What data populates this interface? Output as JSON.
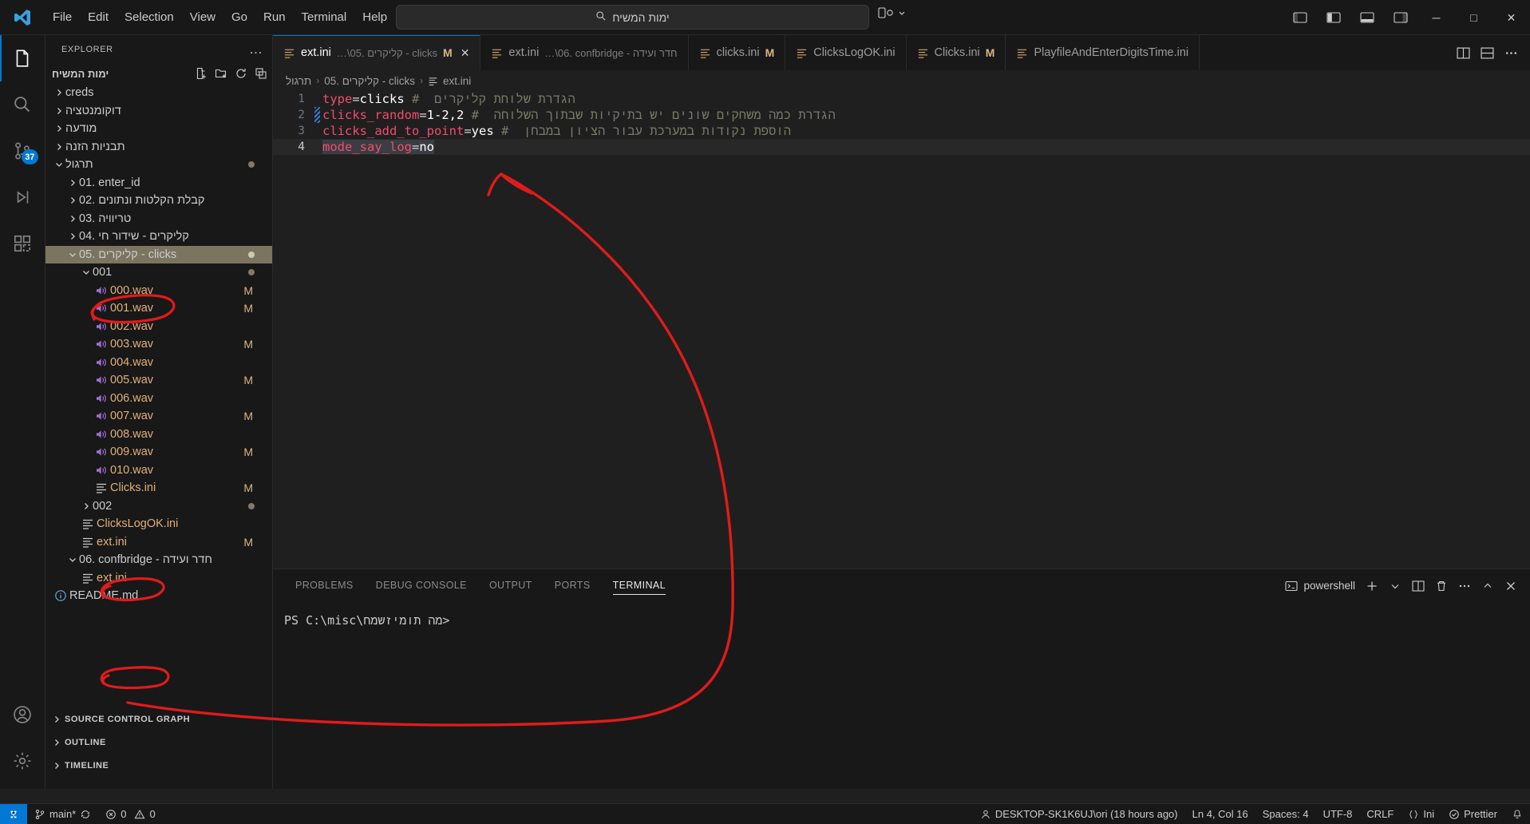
{
  "window": {
    "menu": [
      "File",
      "Edit",
      "Selection",
      "View",
      "Go",
      "Run",
      "Terminal",
      "Help"
    ],
    "search_placeholder": "ימות המשיח",
    "search_icon": "search-icon",
    "nav_back": "‹",
    "nav_forward": "›",
    "minimize": "─",
    "maximize": "□",
    "close": "✕"
  },
  "activitybar": {
    "items": [
      {
        "name": "explorer",
        "icon": "files-icon",
        "badge": ""
      },
      {
        "name": "search",
        "icon": "search-icon",
        "badge": ""
      },
      {
        "name": "source-control",
        "icon": "source-control-icon",
        "badge": "37"
      },
      {
        "name": "run-and-debug",
        "icon": "run-debug-icon",
        "badge": ""
      },
      {
        "name": "extensions",
        "icon": "extensions-icon",
        "badge": ""
      }
    ],
    "bottom": [
      {
        "name": "accounts",
        "icon": "account-icon"
      },
      {
        "name": "manage",
        "icon": "gear-icon"
      }
    ]
  },
  "sidebar": {
    "title": "EXPLORER",
    "more_label": "…",
    "root": "ימות המשיח",
    "root_actions": [
      "new-file-icon",
      "new-folder-icon",
      "refresh-icon",
      "collapse-all-icon"
    ],
    "tree": [
      {
        "label": "creds",
        "depth": 1,
        "type": "folder",
        "state": "collapsed",
        "badge": ""
      },
      {
        "label": "דוקומנטציה",
        "depth": 1,
        "type": "folder",
        "state": "collapsed",
        "badge": ""
      },
      {
        "label": "מודעה",
        "depth": 1,
        "type": "folder",
        "state": "collapsed",
        "badge": ""
      },
      {
        "label": "תבניות הזנה",
        "depth": 1,
        "type": "folder",
        "state": "collapsed",
        "badge": ""
      },
      {
        "label": "תרגול",
        "depth": 1,
        "type": "folder",
        "state": "expanded",
        "badge": "dot"
      },
      {
        "label": "01. enter_id",
        "depth": 2,
        "type": "folder",
        "state": "collapsed",
        "badge": ""
      },
      {
        "label": "02. קבלת הקלטות ונתונים",
        "depth": 2,
        "type": "folder",
        "state": "collapsed",
        "badge": ""
      },
      {
        "label": "03. טריוויה",
        "depth": 2,
        "type": "folder",
        "state": "collapsed",
        "badge": ""
      },
      {
        "label": "04. קליקרים - שידור חי",
        "depth": 2,
        "type": "folder",
        "state": "collapsed",
        "badge": ""
      },
      {
        "label": "05. קליקרים - clicks",
        "depth": 2,
        "type": "folder",
        "state": "expanded",
        "badge": "dot",
        "selected": true
      },
      {
        "label": "001",
        "depth": 3,
        "type": "folder",
        "state": "expanded",
        "badge": "dot",
        "circled": true
      },
      {
        "label": "000.wav",
        "depth": 4,
        "type": "wav",
        "badge": "M"
      },
      {
        "label": "001.wav",
        "depth": 4,
        "type": "wav",
        "badge": "M"
      },
      {
        "label": "002.wav",
        "depth": 4,
        "type": "wav",
        "badge": ""
      },
      {
        "label": "003.wav",
        "depth": 4,
        "type": "wav",
        "badge": "M"
      },
      {
        "label": "004.wav",
        "depth": 4,
        "type": "wav",
        "badge": ""
      },
      {
        "label": "005.wav",
        "depth": 4,
        "type": "wav",
        "badge": "M"
      },
      {
        "label": "006.wav",
        "depth": 4,
        "type": "wav",
        "badge": ""
      },
      {
        "label": "007.wav",
        "depth": 4,
        "type": "wav",
        "badge": "M"
      },
      {
        "label": "008.wav",
        "depth": 4,
        "type": "wav",
        "badge": ""
      },
      {
        "label": "009.wav",
        "depth": 4,
        "type": "wav",
        "badge": "M"
      },
      {
        "label": "010.wav",
        "depth": 4,
        "type": "wav",
        "badge": ""
      },
      {
        "label": "Clicks.ini",
        "depth": 4,
        "type": "ini",
        "badge": "M"
      },
      {
        "label": "002",
        "depth": 3,
        "type": "folder",
        "state": "collapsed",
        "badge": "dot",
        "circled": true
      },
      {
        "label": "ClicksLogOK.ini",
        "depth": 3,
        "type": "ini",
        "badge": ""
      },
      {
        "label": "ext.ini",
        "depth": 3,
        "type": "ini",
        "badge": "M"
      },
      {
        "label": "06. confbridge - חדר ועידה",
        "depth": 2,
        "type": "folder",
        "state": "expanded",
        "badge": ""
      },
      {
        "label": "ext.ini",
        "depth": 3,
        "type": "ini",
        "badge": "",
        "circled": true
      },
      {
        "label": "README.md",
        "depth": 1,
        "type": "md",
        "badge": ""
      }
    ],
    "sections": [
      "SOURCE CONTROL GRAPH",
      "OUTLINE",
      "TIMELINE"
    ]
  },
  "editor": {
    "tabs": [
      {
        "name": "ext.ini",
        "path": "…\\05. קליקרים - clicks",
        "modified": "M",
        "active": true,
        "closable": true
      },
      {
        "name": "ext.ini",
        "path": "…\\06. confbridge - חדר ועידה",
        "modified": "",
        "active": false,
        "closable": false
      },
      {
        "name": "clicks.ini",
        "path": "",
        "modified": "M",
        "active": false,
        "closable": false
      },
      {
        "name": "ClicksLogOK.ini",
        "path": "",
        "modified": "",
        "active": false,
        "closable": false
      },
      {
        "name": "Clicks.ini",
        "path": "",
        "modified": "M",
        "active": false,
        "closable": false
      },
      {
        "name": "PlayfileAndEnterDigitsTime.ini",
        "path": "",
        "modified": "",
        "active": false,
        "closable": false
      }
    ],
    "tab_actions": [
      "split-editor-icon",
      "layout-icon",
      "more-actions-icon"
    ],
    "breadcrumb": [
      "תרגול",
      "05. קליקרים - clicks",
      "ext.ini"
    ],
    "lines": [
      {
        "num": "1",
        "key": "type",
        "eq": "=",
        "val": "clicks",
        "comment": "#  הגדרת שלוחת קליקרים"
      },
      {
        "num": "2",
        "key": "clicks_random",
        "eq": "=",
        "val": "1-2,2",
        "comment": "#  הגדרת כמה משחקים שונים יש בתיקיות שבתוך השלוחה",
        "squiggle": true
      },
      {
        "num": "3",
        "key": "clicks_add_to_point",
        "eq": "=",
        "val": "yes",
        "comment": "#  הוספת נקודות במערכת עבור הציון במבחן"
      },
      {
        "num": "4",
        "key": "mode_say_log",
        "eq": "=",
        "val": "no",
        "comment": "",
        "current": true,
        "selected": true
      }
    ]
  },
  "panel": {
    "tabs": [
      "PROBLEMS",
      "DEBUG CONSOLE",
      "OUTPUT",
      "PORTS",
      "TERMINAL"
    ],
    "active_tab": "TERMINAL",
    "shell_label": "powershell",
    "actions": [
      "new-terminal-icon",
      "chevron-down-icon",
      "split-terminal-icon",
      "trash-icon",
      "more-actions-icon",
      "chevron-up-icon",
      "close-icon"
    ],
    "prompt": "PS C:\\misc\\מה תומיזשמח>"
  },
  "statusbar": {
    "remote_icon": "remote-icon",
    "branch": "main*",
    "sync_icon": "sync-icon",
    "errors": "0",
    "warnings": "0",
    "error_icon": "error-icon",
    "warning_icon": "warning-icon",
    "right": [
      {
        "name": "live-share",
        "label": "DESKTOP-SK1K6UJ\\ori (18 hours ago)",
        "icon": "account-icon"
      },
      {
        "name": "cursor-position",
        "label": "Ln 4, Col 16",
        "icon": ""
      },
      {
        "name": "indentation",
        "label": "Spaces: 4",
        "icon": ""
      },
      {
        "name": "encoding",
        "label": "UTF-8",
        "icon": ""
      },
      {
        "name": "eol",
        "label": "CRLF",
        "icon": ""
      },
      {
        "name": "language-mode",
        "label": "Ini",
        "icon": "braces-icon"
      },
      {
        "name": "prettier",
        "label": "Prettier",
        "icon": "check-circle-icon"
      },
      {
        "name": "notifications",
        "label": "",
        "icon": "bell-icon"
      }
    ]
  },
  "colors": {
    "accent": "#0078d4",
    "annotation": "#e01b1b",
    "selection_row": "#7b7560",
    "modified_badge": "#d5b783"
  }
}
